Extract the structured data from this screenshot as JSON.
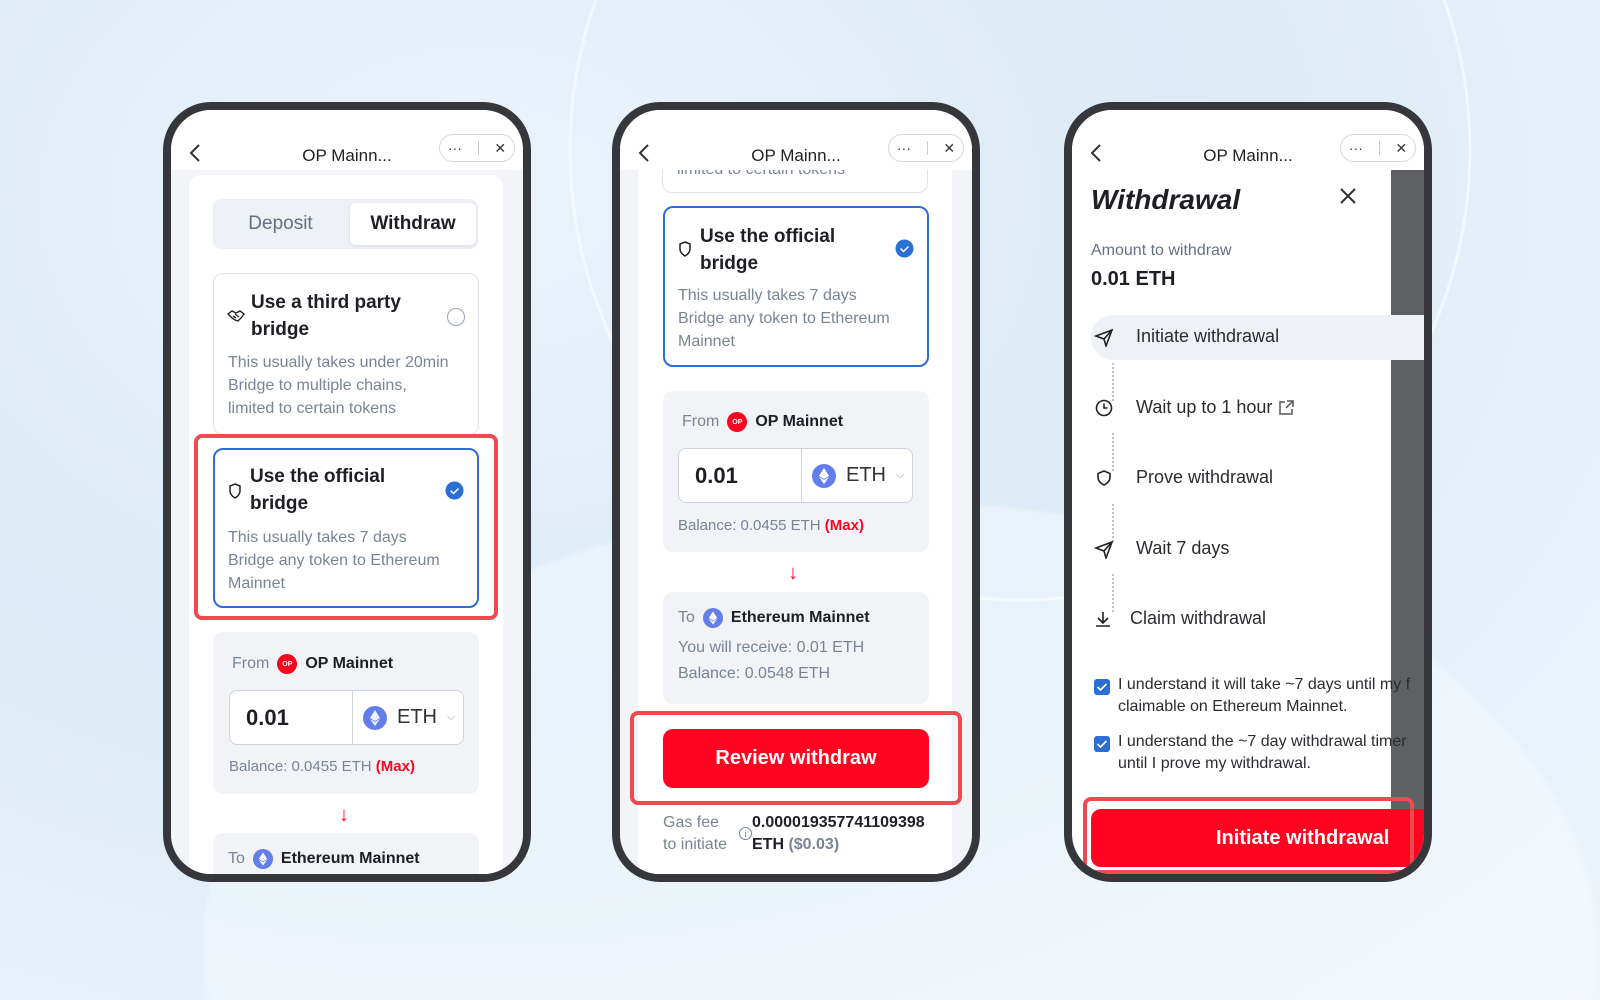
{
  "common": {
    "window_title": "OP Mainn...",
    "more": "···",
    "close": "✕"
  },
  "phone1": {
    "tabs": [
      "Deposit",
      "Withdraw"
    ],
    "active_tab": "Withdraw",
    "third_party": {
      "title_1": "Use a third party",
      "title_2": "bridge",
      "desc": [
        "This usually takes under 20min",
        "Bridge to multiple chains,",
        "limited to certain tokens"
      ],
      "selected": false
    },
    "official": {
      "title_1": "Use the official",
      "title_2": "bridge",
      "desc": [
        "This usually takes 7 days",
        "Bridge any token to Ethereum",
        "Mainnet"
      ],
      "selected": true
    },
    "from": {
      "label": "From",
      "network": "OP Mainnet",
      "logo_text": "OP",
      "amount": "0.01",
      "token": "ETH",
      "balance": "Balance: 0.0455 ETH",
      "max": "(Max)"
    },
    "to": {
      "label": "To",
      "network": "Ethereum Mainnet"
    }
  },
  "phone2": {
    "partial_text": "limited to certain tokens",
    "official": {
      "title_1": "Use the official",
      "title_2": "bridge",
      "desc": [
        "This usually takes 7 days",
        "Bridge any token to Ethereum",
        "Mainnet"
      ]
    },
    "from": {
      "label": "From",
      "network": "OP Mainnet",
      "logo_text": "OP",
      "amount": "0.01",
      "token": "ETH",
      "balance": "Balance: 0.0455 ETH",
      "max": "(Max)"
    },
    "to": {
      "label": "To",
      "network": "Ethereum Mainnet",
      "receive": "You will receive: 0.01 ETH",
      "balance": "Balance: 0.0548 ETH"
    },
    "review_button": "Review withdraw",
    "gas": {
      "label_1": "Gas fee",
      "label_2": "to initiate",
      "value": "0.000019357741109398",
      "unit": "ETH",
      "usd": "($0.03)"
    }
  },
  "phone3": {
    "title": "Withdrawal",
    "amount_label": "Amount to withdraw",
    "amount": "0.01 ETH",
    "steps": [
      "Initiate withdrawal",
      "Wait up to 1 hour",
      "Prove withdrawal",
      "Wait 7 days",
      "Claim withdrawal"
    ],
    "checks": [
      {
        "line1": "I understand it will take ~7 days until my f",
        "line2": "claimable on Ethereum Mainnet.",
        "checked": true
      },
      {
        "line1": "I understand the ~7 day withdrawal timer",
        "line2": "until I prove my withdrawal.",
        "checked": true
      }
    ],
    "button": "Initiate withdrawal"
  },
  "colors": {
    "brand_red": "#ff0420",
    "select_blue": "#2b6fd6",
    "highlight": "#ef4a4f"
  }
}
